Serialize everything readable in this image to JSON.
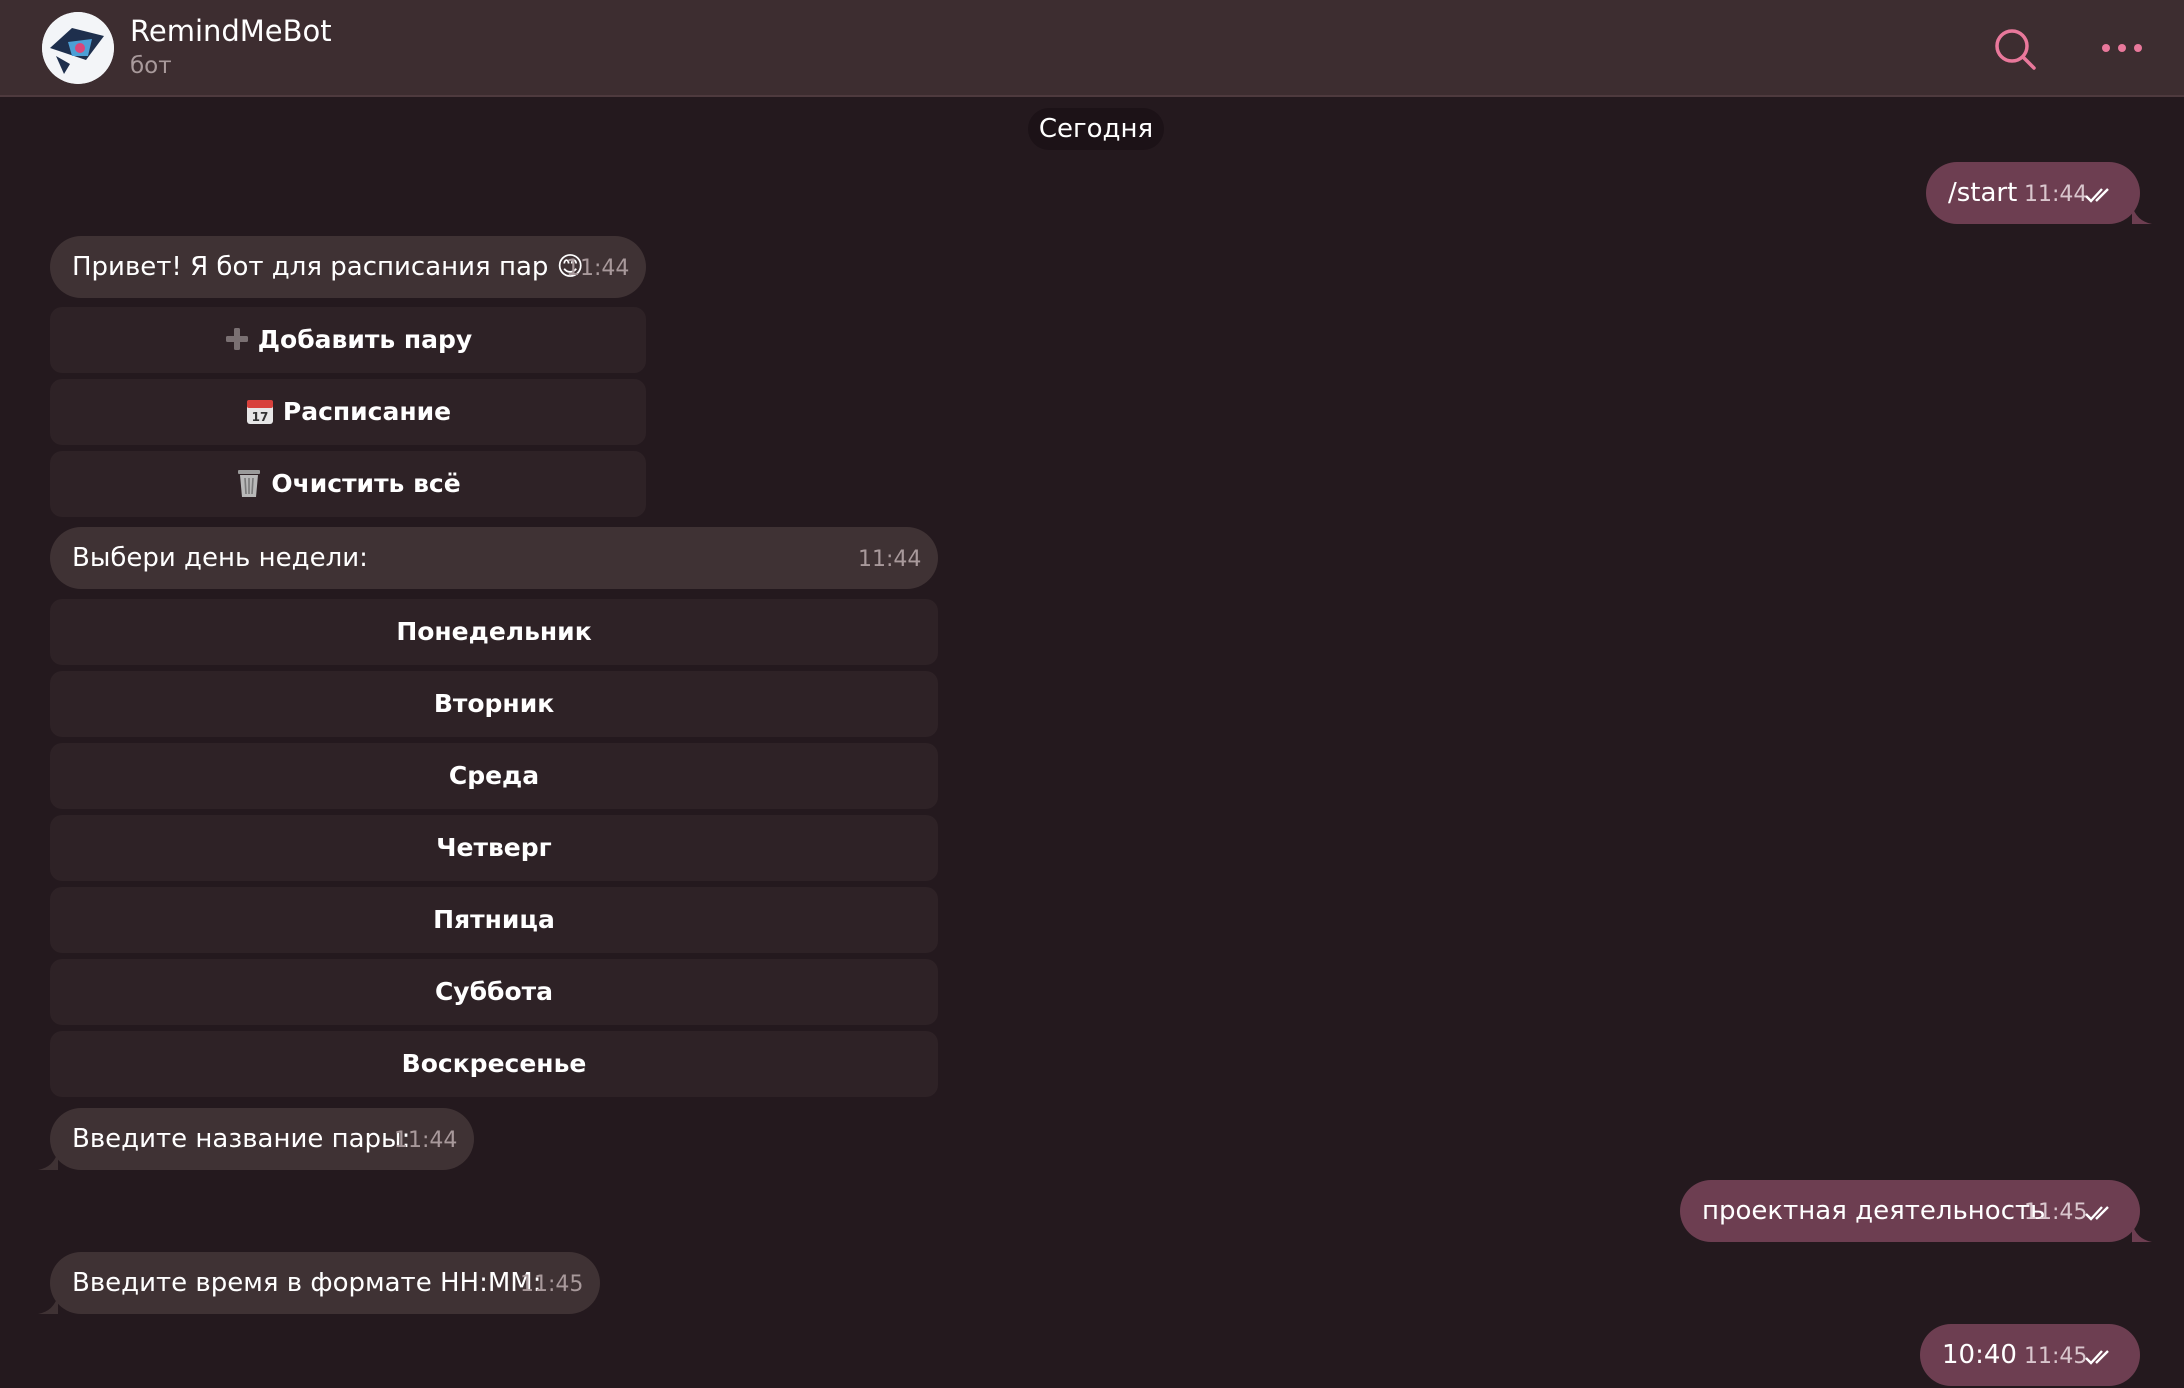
{
  "header": {
    "title": "RemindMeBot",
    "subtitle": "бот",
    "search_icon": "search-icon",
    "menu_icon": "more-horizontal-icon",
    "accent_color": "#e9789b"
  },
  "date_separator": "Сегодня",
  "messages": [
    {
      "direction": "out",
      "text": "/start",
      "time": "11:44",
      "status": "read"
    },
    {
      "direction": "in",
      "text": "Привет! Я бот для расписания пар 😊",
      "time": "11:44"
    },
    {
      "direction": "in",
      "text": "Выбери день недели:",
      "time": "11:44"
    },
    {
      "direction": "in",
      "text": "Введите название пары:",
      "time": "11:44"
    },
    {
      "direction": "out",
      "text": "проектная деятельность",
      "time": "11:45",
      "status": "read"
    },
    {
      "direction": "in",
      "text": "Введите время в формате HH:MM:",
      "time": "11:45"
    },
    {
      "direction": "out",
      "text": "10:40",
      "time": "11:45",
      "status": "read"
    }
  ],
  "main_keyboard": [
    {
      "label": "Добавить пару",
      "icon": "plus-icon"
    },
    {
      "label": "Расписание",
      "icon": "calendar-icon"
    },
    {
      "label": "Очистить всё",
      "icon": "trash-icon"
    }
  ],
  "day_keyboard": [
    {
      "label": "Понедельник"
    },
    {
      "label": "Вторник"
    },
    {
      "label": "Среда"
    },
    {
      "label": "Четверг"
    },
    {
      "label": "Пятница"
    },
    {
      "label": "Суббота"
    },
    {
      "label": "Воскресенье"
    }
  ],
  "colors": {
    "background": "#24191e",
    "header": "#3d2d30",
    "incoming_bubble": "#3f3234",
    "outgoing_bubble": "#6d3e51",
    "keyboard_button": "#2e2226"
  }
}
